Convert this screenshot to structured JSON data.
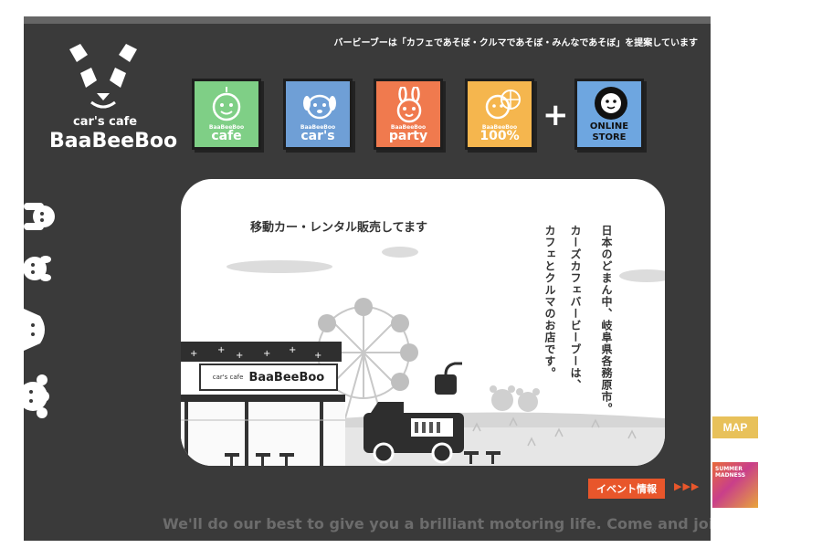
{
  "header": {
    "tagline": "バービーブーは「カフェであそぼ・クルマであそぼ・みんなであそぼ」を提案しています"
  },
  "logo": {
    "subtitle": "car's cafe",
    "title": "BaaBeeBoo"
  },
  "nav": {
    "tiles": [
      {
        "label": "cafe",
        "brand": "BaaBeeBoo",
        "color": "#7fcf86"
      },
      {
        "label": "car's",
        "brand": "BaaBeeBoo",
        "color": "#6f9fd6"
      },
      {
        "label": "party",
        "brand": "BaaBeeBoo",
        "color": "#f07a4e"
      },
      {
        "label": "100%",
        "brand": "BaaBeeBoo",
        "color": "#f5b64e"
      }
    ],
    "plus": "+",
    "store": {
      "line1": "ONLINE",
      "line2": "STORE",
      "color": "#6ea6e0"
    }
  },
  "hero": {
    "caption": "移動カー・レンタル販売してます",
    "vertical_lines": [
      "日本のどまん中、岐阜県各務原市。",
      "カーズカフェバービーブーは、",
      "カフェとクルマのお店です。"
    ],
    "shop_sign": {
      "small": "car's cafe",
      "big": "BaaBeeBoo"
    }
  },
  "event": {
    "label": "イベント情報",
    "arrows": "▶▶▶"
  },
  "footer": {
    "slogan": "We'll do our best to give you a brilliant motoring life. Come and join us!"
  },
  "side_banners": {
    "map_label": "MAP",
    "summer_label": "SUMMER MADNESS"
  },
  "colors": {
    "panel": "#3a3a3a",
    "accent": "#e8562b"
  }
}
